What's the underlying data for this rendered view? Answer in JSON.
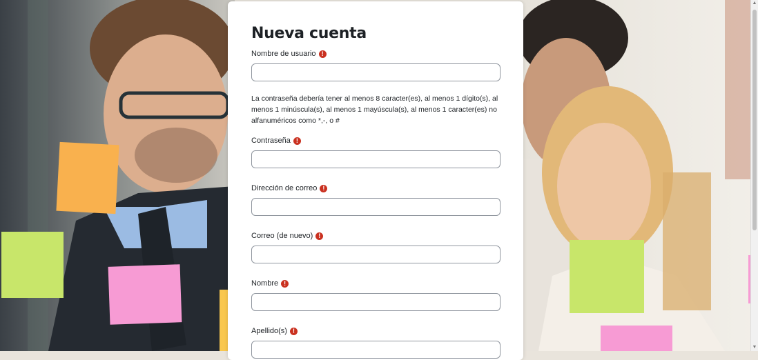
{
  "form": {
    "title": "Nueva cuenta",
    "required_symbol": "!",
    "password_hint": "La contraseña debería tener al menos 8 caracter(es), al menos 1 dígito(s), al menos 1 minúscula(s), al menos 1 mayúscula(s), al menos 1 caracter(es) no alfanuméricos como *,-, o #",
    "fields": [
      {
        "label": "Nombre de usuario",
        "value": ""
      },
      {
        "label": "Contraseña",
        "value": ""
      },
      {
        "label": "Dirección de correo",
        "value": ""
      },
      {
        "label": "Correo (de nuevo)",
        "value": ""
      },
      {
        "label": "Nombre",
        "value": ""
      },
      {
        "label": "Apellido(s)",
        "value": ""
      }
    ]
  },
  "colors": {
    "required_icon": "#ca3120",
    "card_background": "#ffffff",
    "sticky_orange": "#f9b14e",
    "sticky_green": "#c8e66a",
    "sticky_pink": "#f79bd4"
  },
  "icons": {
    "required": "exclamation-circle-icon"
  }
}
